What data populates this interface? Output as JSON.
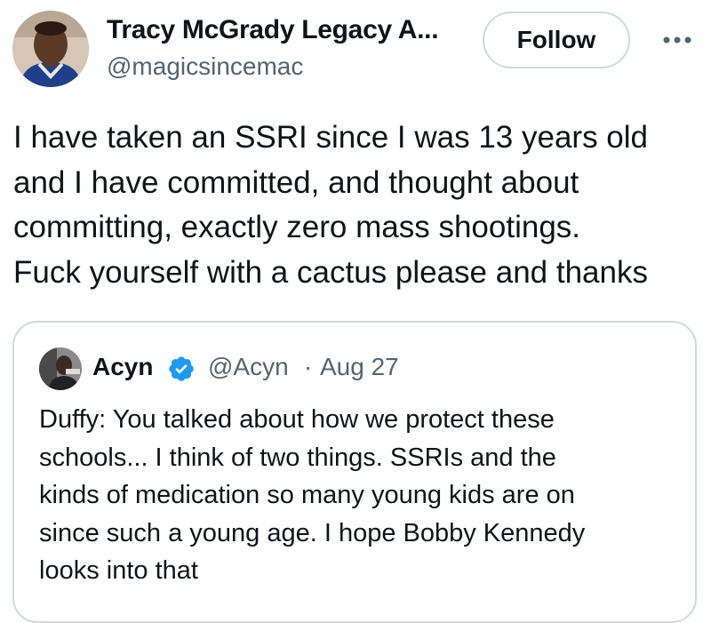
{
  "tweet": {
    "author": {
      "display_name": "Tracy McGrady Legacy A...",
      "handle": "@magicsincemac",
      "avatar_icon": "profile-photo"
    },
    "follow_label": "Follow",
    "more_icon": "more-options-icon",
    "text_lines": [
      "I have taken an SSRI since I was 13 years old",
      "and I have committed, and thought about",
      "committing, exactly zero mass shootings.",
      "Fuck yourself with a cactus please and thanks"
    ]
  },
  "quote": {
    "author": {
      "display_name": "Acyn",
      "handle": "@Acyn",
      "verified_icon": "verified-badge-icon",
      "avatar_icon": "profile-photo"
    },
    "separator": "·",
    "date": "Aug 27",
    "text_lines": [
      "Duffy: You talked about how we protect these",
      "schools... I think of two things. SSRIs and the",
      "kinds of medication so many young kids are on",
      "since such a young age. I hope Bobby Kennedy",
      "looks into that"
    ]
  },
  "colors": {
    "primary_text": "#0f1419",
    "secondary_text": "#536471",
    "border": "#cfd9de",
    "verified_blue": "#1d9bf0"
  }
}
